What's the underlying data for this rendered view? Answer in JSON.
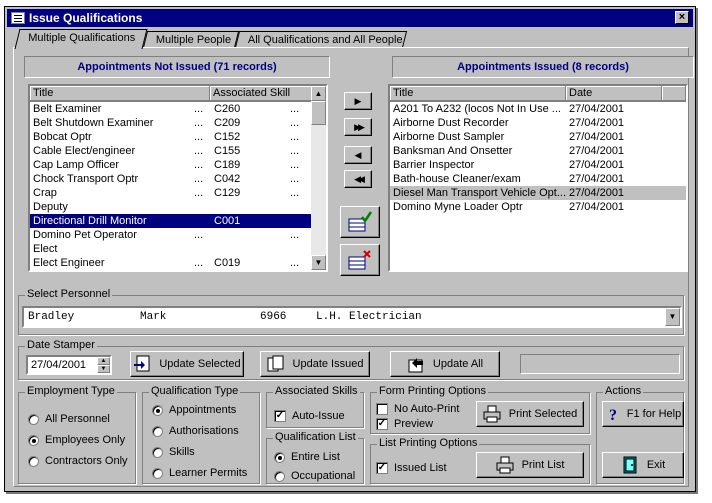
{
  "window": {
    "title": "Issue Qualifications",
    "close_label": "×"
  },
  "tabs": [
    {
      "label": "Multiple Qualifications"
    },
    {
      "label": "Multiple People"
    },
    {
      "label": "All Qualifications and All People"
    }
  ],
  "not_issued": {
    "header": "Appointments Not Issued (71 records)",
    "col_title": "Title",
    "col_skill": "Associated Skill",
    "rows": [
      {
        "title": "Belt Examiner",
        "dots": "...",
        "skill": "C260",
        "dots2": "..."
      },
      {
        "title": "Belt Shutdown Examiner",
        "dots": "...",
        "skill": "C209",
        "dots2": "..."
      },
      {
        "title": "Bobcat Optr",
        "dots": "...",
        "skill": "C152",
        "dots2": "..."
      },
      {
        "title": "Cable Elect/engineer",
        "dots": "...",
        "skill": "C155",
        "dots2": "..."
      },
      {
        "title": "Cap Lamp Officer",
        "dots": "...",
        "skill": "C189",
        "dots2": "..."
      },
      {
        "title": "Chock Transport Optr",
        "dots": "...",
        "skill": "C042",
        "dots2": "..."
      },
      {
        "title": "Crap",
        "dots": "...",
        "skill": "C129",
        "dots2": "..."
      },
      {
        "title": "Deputy",
        "dots": "",
        "skill": "",
        "dots2": ""
      },
      {
        "title": "Directional Drill Monitor",
        "dots": "",
        "skill": "C001",
        "dots2": ""
      },
      {
        "title": "Domino Pet Operator",
        "dots": "...",
        "skill": "",
        "dots2": "..."
      },
      {
        "title": "Elect",
        "dots": "",
        "skill": "",
        "dots2": ""
      },
      {
        "title": "Elect Engineer",
        "dots": "...",
        "skill": "C019",
        "dots2": "..."
      }
    ]
  },
  "issued": {
    "header": "Appointments Issued (8 records)",
    "col_title": "Title",
    "col_date": "Date",
    "rows": [
      {
        "title": "A201 To A232 (locos Not In Use ...",
        "date": "27/04/2001"
      },
      {
        "title": "Airborne Dust Recorder",
        "date": "27/04/2001"
      },
      {
        "title": "Airborne Dust Sampler",
        "date": "27/04/2001"
      },
      {
        "title": "Banksman And Onsetter",
        "date": "27/04/2001"
      },
      {
        "title": "Barrier Inspector",
        "date": "27/04/2001"
      },
      {
        "title": "Bath-house Cleaner/exam",
        "date": "27/04/2001"
      },
      {
        "title": "Diesel Man Transport Vehicle Opt...",
        "date": "27/04/2001"
      },
      {
        "title": "Domino Myne Loader Optr",
        "date": "27/04/2001"
      }
    ]
  },
  "move_buttons": [
    "▶",
    "▶▶",
    "◀",
    "◀◀"
  ],
  "select_personnel": {
    "label": "Select Personnel",
    "surname": "Bradley",
    "firstname": "Mark",
    "number": "6966",
    "role": "L.H. Electrician"
  },
  "date_stamper": {
    "label": "Date Stamper",
    "date": "27/04/2001",
    "update_selected": "Update Selected",
    "update_issued": "Update Issued",
    "update_all": "Update All"
  },
  "employment_type": {
    "label": "Employment Type",
    "options": [
      "All Personnel",
      "Employees Only",
      "Contractors Only"
    ],
    "selected": 1
  },
  "qualification_type": {
    "label": "Qualification Type",
    "options": [
      "Appointments",
      "Authorisations",
      "Skills",
      "Learner Permits"
    ],
    "selected": 0
  },
  "associated_skills": {
    "label": "Associated Skills",
    "auto_issue": "Auto-Issue"
  },
  "qualification_list": {
    "label": "Qualification List",
    "options": [
      "Entire List",
      "Occupational"
    ],
    "selected": 0
  },
  "form_printing": {
    "label": "Form Printing Options",
    "no_auto_print": "No Auto-Print",
    "preview": "Preview",
    "print_selected": "Print Selected"
  },
  "list_printing": {
    "label": "List Printing Options",
    "issued_list": "Issued List",
    "print_list": "Print List"
  },
  "actions": {
    "label": "Actions",
    "help": "F1 for Help",
    "exit": "Exit"
  }
}
